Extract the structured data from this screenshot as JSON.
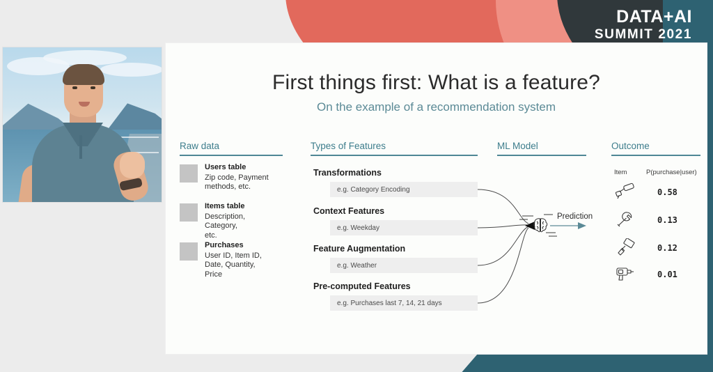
{
  "brand": {
    "line1": "DATA+AI",
    "line2": "SUMMIT 2021"
  },
  "theme": {
    "coral": "#e2695c",
    "salmon": "#ef9084",
    "charcoal": "#30383b",
    "teal": "#2e6272",
    "accent_teal": "#3d7d8c",
    "panel": "#fcfdfb",
    "page_bg": "#ececec",
    "box_gray": "#eeeeee",
    "square_gray": "#c4c4c4"
  },
  "slide": {
    "title": "First things first: What is a feature?",
    "subtitle": "On the example of a recommendation system",
    "columns": {
      "raw_data": {
        "header": "Raw data",
        "items": [
          {
            "name": "Users table",
            "detail": "Zip code, Payment\nmethods, etc."
          },
          {
            "name": "Items table",
            "detail": "Description,\nCategory,\netc."
          },
          {
            "name": "Purchases",
            "detail": "User ID, Item ID,\nDate, Quantity,\nPrice"
          }
        ]
      },
      "types_of_features": {
        "header": "Types of Features",
        "items": [
          {
            "title": "Transformations",
            "example": "e.g. Category Encoding"
          },
          {
            "title": "Context Features",
            "example": "e.g. Weekday"
          },
          {
            "title": "Feature Augmentation",
            "example": "e.g. Weather"
          },
          {
            "title": "Pre-computed Features",
            "example": "e.g. Purchases last 7, 14, 21 days"
          }
        ]
      },
      "ml_model": {
        "header": "ML Model",
        "icon": "brain-icon",
        "output_label": "Prediction"
      },
      "outcome": {
        "header": "Outcome",
        "table_headers": [
          "Item",
          "P(purchase|user)"
        ],
        "rows": [
          {
            "icon": "paint-roller-icon",
            "probability": "0.58"
          },
          {
            "icon": "wrench-icon",
            "probability": "0.13"
          },
          {
            "icon": "paintbrush-icon",
            "probability": "0.12"
          },
          {
            "icon": "drill-icon",
            "probability": "0.01"
          }
        ]
      }
    }
  },
  "speaker_video": {
    "label": "speaker-video-tile"
  }
}
